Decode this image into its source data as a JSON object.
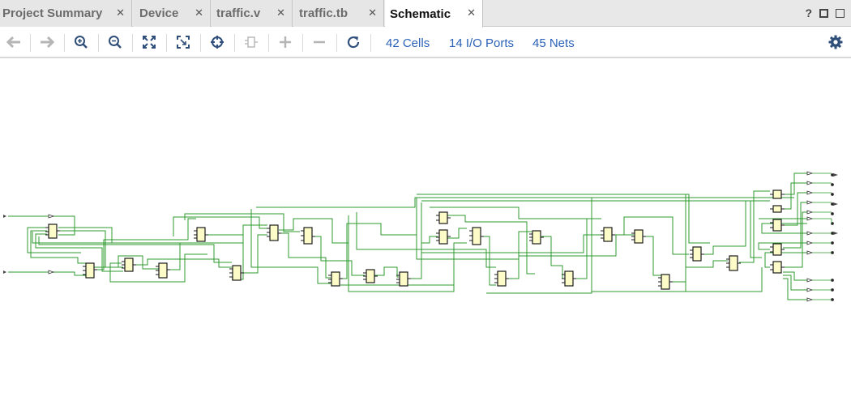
{
  "tabs": [
    {
      "label": "Project Summary",
      "active": false
    },
    {
      "label": "Device",
      "active": false
    },
    {
      "label": "traffic.v",
      "active": false
    },
    {
      "label": "traffic.tb",
      "active": false
    },
    {
      "label": "Schematic",
      "active": true
    }
  ],
  "tab_tools": {
    "help": "?"
  },
  "toolbar": {
    "icons": [
      "back-arrow-icon",
      "forward-arrow-icon",
      "zoom-in-icon",
      "zoom-out-icon",
      "zoom-fit-icon",
      "zoom-area-icon",
      "crosshair-icon",
      "cell-icon",
      "plus-icon",
      "minus-icon",
      "refresh-icon"
    ],
    "cells_label": "42 Cells",
    "ports_label": "14 I/O Ports",
    "nets_label": "45 Nets"
  },
  "colors": {
    "wire": "#2e9a2e",
    "cell_fill": "#fdfbc8",
    "link": "#2b62b8"
  }
}
